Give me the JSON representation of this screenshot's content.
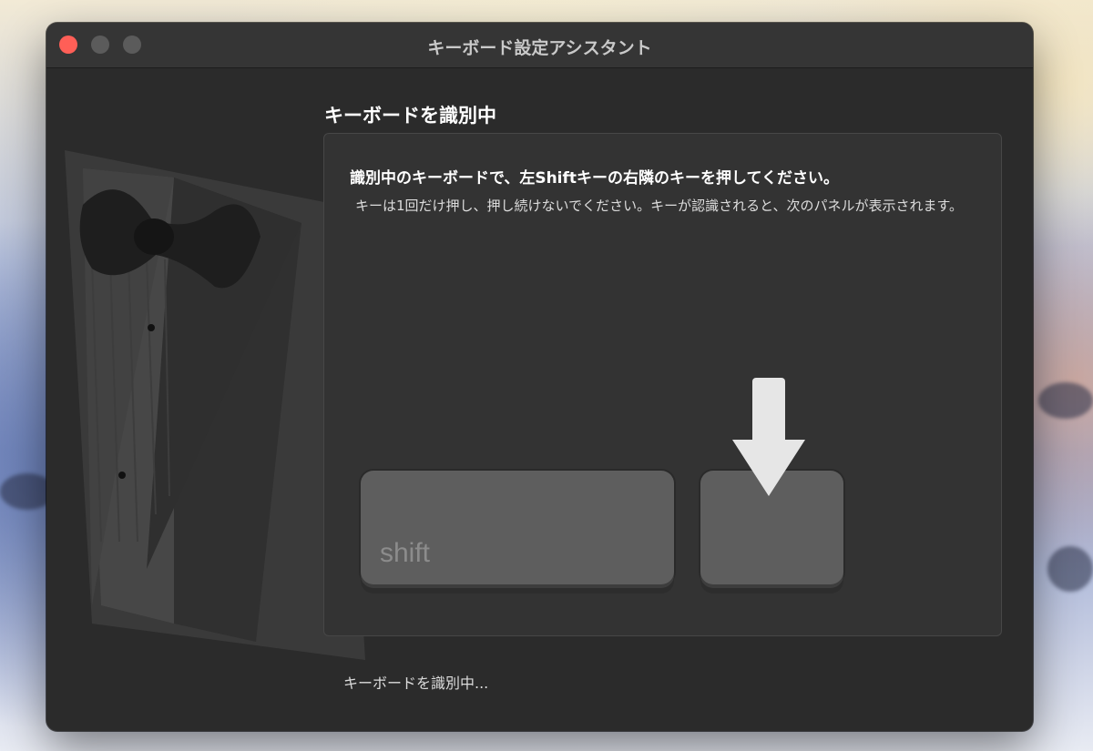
{
  "window": {
    "title": "キーボード設定アシスタント"
  },
  "content": {
    "heading": "キーボードを識別中",
    "instruction": "識別中のキーボードで、左Shiftキーの右隣のキーを押してください。",
    "detail": "キーは1回だけ押し、押し続けないでください。キーが認識されると、次のパネルが表示されます。",
    "keys": {
      "shift_label": "shift"
    },
    "arrow_icon": "down-arrow-icon"
  },
  "footer": {
    "status": "キーボードを識別中..."
  },
  "colors": {
    "close": "#ff5f57",
    "window_bg": "#2b2b2b",
    "key": "#5e5e5e"
  }
}
